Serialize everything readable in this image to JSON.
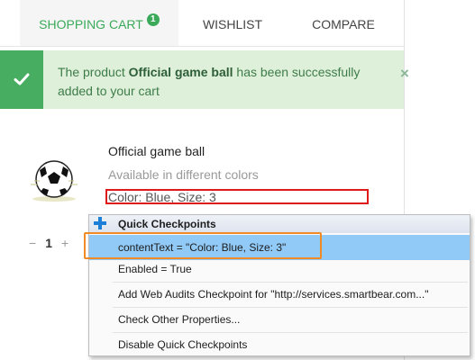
{
  "tabs": [
    {
      "label": "SHOPPING CART",
      "badge": "1"
    },
    {
      "label": "WISHLIST"
    },
    {
      "label": "COMPARE"
    }
  ],
  "alert": {
    "text_before": "The product ",
    "product": "Official game ball",
    "text_after": " has been successfully added to your cart",
    "close": "×"
  },
  "product": {
    "name": "Official game ball",
    "availability": "Available in different colors",
    "attributes": "Color: Blue, Size: 3",
    "quantity": "1",
    "minus": "−",
    "plus": "+"
  },
  "context_menu": {
    "header": "Quick Checkpoints",
    "items": [
      "contentText = \"Color: Blue, Size: 3\"",
      "Enabled = True",
      "Add Web Audits Checkpoint for \"http://services.smartbear.com...\"",
      "Check Other Properties...",
      "Disable Quick Checkpoints"
    ]
  },
  "colors": {
    "accent_green": "#3aaa5a",
    "alert_bg": "#def0d9",
    "highlight_red": "#e01a1a",
    "highlight_orange": "#f08a24",
    "menu_selected": "#91c9f7"
  }
}
